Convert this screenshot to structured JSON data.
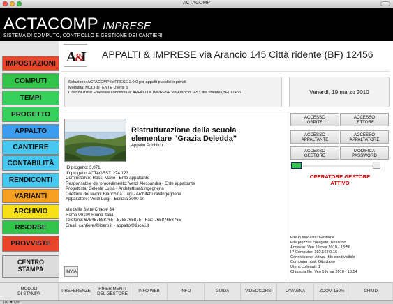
{
  "window": {
    "title": "ACTACOMP"
  },
  "header": {
    "brand": "ACTACOMP",
    "brand_suffix": "IMPRESE",
    "subtitle": "SISTEMA DI COMPUTO, CONTROLLO E GESTIONE DEI CANTIERI"
  },
  "nav": {
    "items": [
      {
        "label": "IMPOSTAZIONI",
        "color": "#e8442a"
      },
      {
        "label": "COMPUTI",
        "color": "#31c34a"
      },
      {
        "label": "TEMPI",
        "color": "#35d15b"
      },
      {
        "label": "PROGETTO",
        "color": "#35d15b"
      },
      {
        "label": "APPALTO",
        "color": "#3a9df0"
      },
      {
        "label": "CANTIERE",
        "color": "#45c7ef"
      },
      {
        "label": "CONTABILITÀ",
        "color": "#45c7ef"
      },
      {
        "label": "RENDICONTI",
        "color": "#45c7ef"
      },
      {
        "label": "VARIANTI",
        "color": "#f6a021"
      },
      {
        "label": "ARCHIVIO",
        "color": "#f7e017"
      },
      {
        "label": "RISORSE",
        "color": "#31c34a"
      },
      {
        "label": "PROVVISTE",
        "color": "#e8442a"
      },
      {
        "label": "CENTRO STAMPA",
        "color": "#dcdcdc"
      }
    ]
  },
  "main": {
    "logo_text": "A&I",
    "app_title": "APPALTI & IMPRESE via Arancio 145 Città ridente (BF) 12456",
    "license_lines": [
      "Soluzione: ACTACOMP IMPRESE 2.0.0 per appalti pubblici e privati",
      "Modalità: MULTIUTENTE  Utenti: 5",
      "Licenza d'uso Freeware concessa a: APPALTI & IMPRESE via Arancio 145 Città ridente (BF) 12456"
    ],
    "date": "Venerdì, 19 marzo 2010",
    "project": {
      "title": "Ristrutturazione della scuola elementare \"Grazia Deledda\"",
      "type": "Appalto Pubblico",
      "details": [
        "ID progetto: 3.071",
        "ID progetto ACTAGEST: 274.123",
        "Committente: Rossi Mario - Ente appaltante",
        "Responsabile del procedimento: Verdi Alessandra - Ente appaltante",
        "Progettista: Celeste Luisa - Architettura&Ingegneria",
        "Direttore dei lavori: Bianchina Luigi - Architettura&Ingegneria",
        "Appaltatore: Verdi Luigi - Edilizia 3000 srl",
        "",
        "Via delle Sette Chiese 34",
        "Roma 00100 Roma Italia",
        "Telefono: 675487658765 - 8758765875 - Fax: 76587658765",
        "Email: cantiere@libero.it - appalto@tiscali.it"
      ]
    },
    "send_button": "INVIA"
  },
  "access": {
    "buttons": [
      {
        "label1": "ACCESSO",
        "label2": "OSPITE"
      },
      {
        "label1": "ACCESSO",
        "label2": "LETTORE"
      },
      {
        "label1": "ACCESSO",
        "label2": "APPALTANTE"
      },
      {
        "label1": "ACCESSO",
        "label2": "APPALTATORE"
      },
      {
        "label1": "ACCESSO",
        "label2": "GESTORE"
      },
      {
        "label1": "MODIFICA",
        "label2": "PASSWORD"
      }
    ],
    "operator_status_line1": "OPERATORE GESTORE",
    "operator_status_line2": "ATTIVO",
    "status_color": "#dd0000",
    "file_info": [
      "File in modalità: Gestione",
      "File prezzari collegato: Nessuno",
      "Accesso: Ven 19 mar 2010 - 13:56",
      "IP Computer: 192.168.0.16",
      "Condivisione: Attiva - file condivisibile",
      "Computer host: Ottaviano",
      "Utenti collegati: 1",
      "Chiusura file: Ven 19 mar 2010 - 13:54"
    ]
  },
  "bottom": {
    "buttons": [
      {
        "label1": "MODULI",
        "label2": "DI STAMPA"
      },
      {
        "label1": "PREFERENZE",
        "label2": ""
      },
      {
        "label1": "RIFERIMENTI",
        "label2": "DEL GESTORE"
      },
      {
        "label1": "INFO WEB",
        "label2": ""
      },
      {
        "label1": "INFO",
        "label2": ""
      },
      {
        "label1": "GUIDA",
        "label2": ""
      },
      {
        "label1": "VIDEOCORSI",
        "label2": ""
      },
      {
        "label1": "LAVAGNA",
        "label2": ""
      },
      {
        "label1": "ZOOM 150%",
        "label2": ""
      },
      {
        "label1": "CHIUDI",
        "label2": ""
      }
    ],
    "status_strip": "100 ▼  Uso"
  }
}
